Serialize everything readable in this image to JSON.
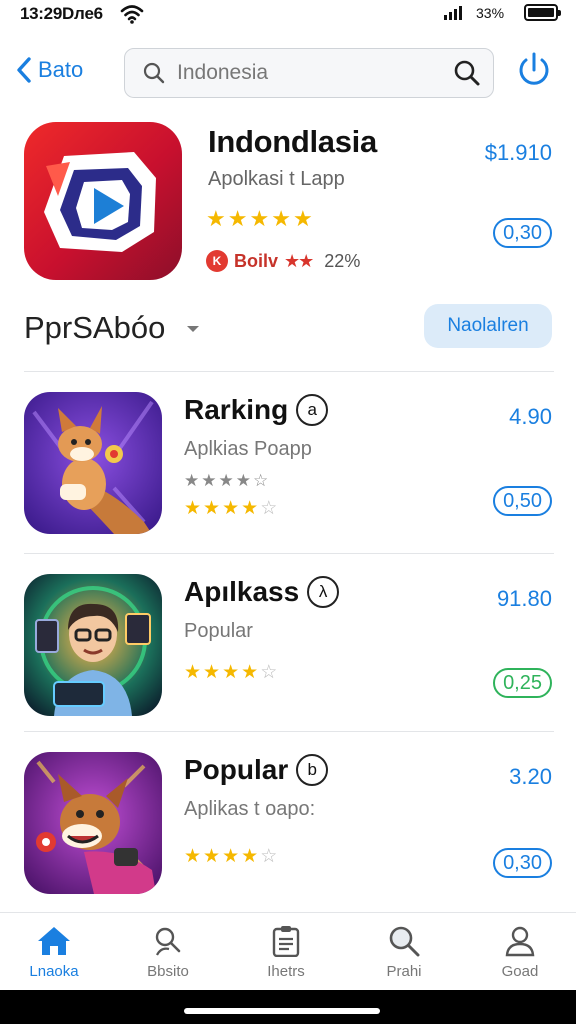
{
  "status_bar": {
    "time": "13:29Dлe6",
    "battery": "33%"
  },
  "nav": {
    "back_label": "Ваto",
    "search_value": "Indonesia"
  },
  "featured": {
    "title": "Indondlasia",
    "subtitle": "Apolkasi t Lapp",
    "rating": 5,
    "price": "$1.910",
    "action": "0,30",
    "meta": {
      "badge": "K",
      "label": "Boilv",
      "stars": 2,
      "percent": "22%"
    }
  },
  "section": {
    "title": "PprSAbóo",
    "button_label": "Naolalren"
  },
  "apps": [
    {
      "title": "Rarking",
      "badge": "a",
      "subtitle": "Aplkias Poapp",
      "gray_stars": 5,
      "rating": 3.5,
      "price": "4.90",
      "action": "0,50",
      "action_color": "#1a7fe0"
    },
    {
      "title": "Apılkass",
      "badge": "λ",
      "subtitle": "Popular",
      "rating": 3.5,
      "price": "91.80",
      "action": "0,25",
      "action_color": "#2fb35b"
    },
    {
      "title": "Popular",
      "badge": "b",
      "subtitle": "Aplikas t oapo:",
      "rating": 3.5,
      "price": "3.20",
      "action": "0,30",
      "action_color": "#1a7fe0"
    }
  ],
  "tabs": [
    {
      "label": "Lnaoka",
      "icon": "home-icon",
      "active": true
    },
    {
      "label": "Bbsito",
      "icon": "search-person-icon",
      "active": false
    },
    {
      "label": "Ihetrs",
      "icon": "clipboard-icon",
      "active": false
    },
    {
      "label": "Prahi",
      "icon": "search-icon",
      "active": false
    },
    {
      "label": "Goad",
      "icon": "person-icon",
      "active": false
    }
  ],
  "colors": {
    "accent": "#1a7fe0",
    "star": "#f5b800",
    "green": "#2fb35b",
    "red": "#e23a31"
  }
}
